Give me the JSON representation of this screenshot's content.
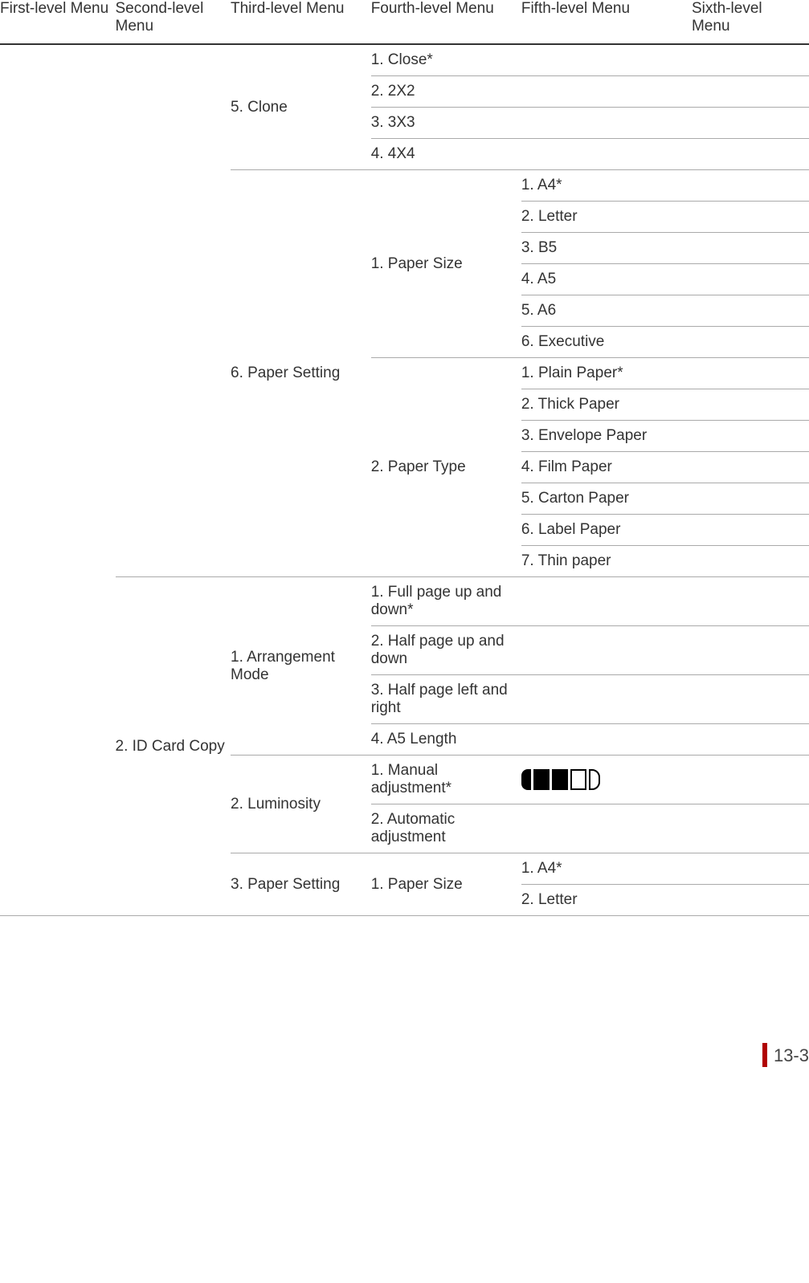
{
  "headers": {
    "c1": "First-level Menu",
    "c2": "Second-level Menu",
    "c3": "Third-level Menu",
    "c4": "Fourth-level Menu",
    "c5": "Fifth-level Menu",
    "c6": "Sixth-level Menu"
  },
  "groupA": {
    "third": "5. Clone",
    "items": [
      "1. Close*",
      "2. 2X2",
      "3. 3X3",
      "4. 4X4"
    ]
  },
  "groupB": {
    "third": "6. Paper Setting",
    "sub1": {
      "fourth": "1. Paper Size",
      "items": [
        "1. A4*",
        "2. Letter",
        "3. B5",
        "4. A5",
        "5. A6",
        "6. Executive"
      ]
    },
    "sub2": {
      "fourth": "2. Paper Type",
      "items": [
        "1. Plain Paper*",
        "2. Thick Paper",
        "3. Envelope Paper",
        "4. Film Paper",
        "5. Carton Paper",
        "6. Label Paper",
        "7. Thin paper"
      ]
    }
  },
  "groupC": {
    "second": "2. ID Card Copy",
    "sub1": {
      "third": "1. Arrangement Mode",
      "items": [
        "1. Full page up and down*",
        "2. Half page up and down",
        "3. Half page left and right",
        "4. A5 Length"
      ]
    },
    "sub2": {
      "third": "2. Luminosity",
      "items": [
        "1. Manual adjustment*",
        "2. Automatic adjustment"
      ]
    },
    "sub3": {
      "third": "3. Paper Setting",
      "sub": {
        "fourth": "1. Paper Size",
        "items": [
          "1. A4*",
          "2. Letter"
        ]
      }
    }
  },
  "pageNumber": "13-3"
}
